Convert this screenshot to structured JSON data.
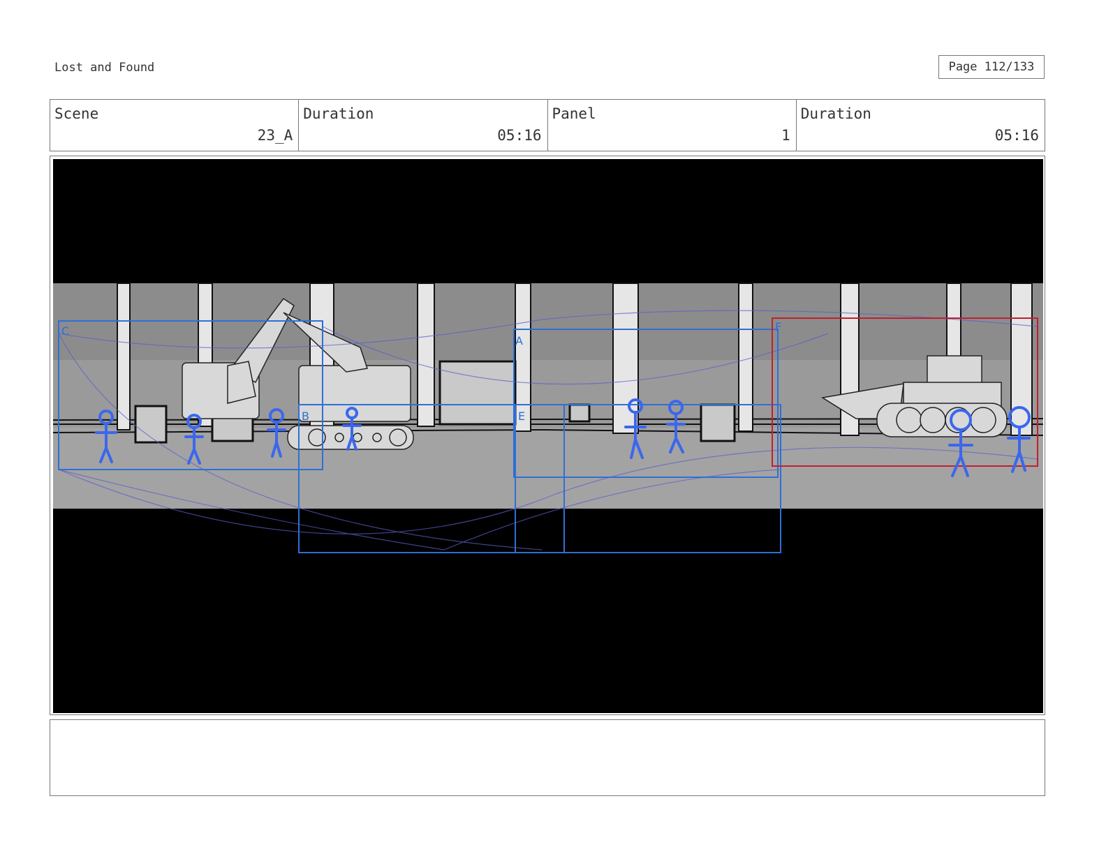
{
  "header": {
    "title": "Lost and Found",
    "page": "Page 112/133"
  },
  "info": {
    "scene_label": "Scene",
    "scene_value": "23_A",
    "duration_label": "Duration",
    "duration_value": "05:16",
    "panel_label": "Panel",
    "panel_value": "1",
    "panel_duration_label": "Duration",
    "panel_duration_value": "05:16"
  },
  "frame": {
    "camera_labels": [
      "C",
      "A",
      "B",
      "E",
      "F"
    ],
    "colors": {
      "letterbox": "#000000",
      "background": "#9a9a9a",
      "camera_box": "#2f6fd6",
      "active_box": "#c0202a",
      "figures": "#3b67ee"
    }
  },
  "notes": {
    "text": ""
  }
}
